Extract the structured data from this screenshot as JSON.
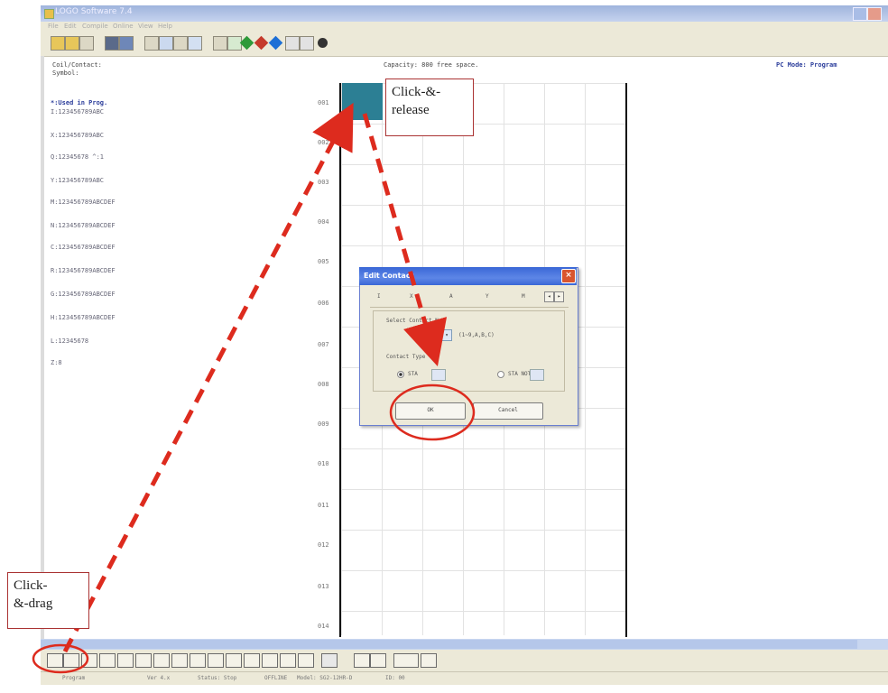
{
  "window": {
    "title": "LOGO Software 7.4",
    "menu": [
      "File",
      "Edit",
      "Compile",
      "Online",
      "View",
      "Help"
    ]
  },
  "info": {
    "coil_contact_label": "Coil/Contact:",
    "symbol_label": "Symbol:",
    "capacity": "Capacity: 800 free space.",
    "mode": "PC Mode: Program",
    "used_header": "*:Used in Prog.",
    "ranges": [
      "I:123456789ABC",
      "X:123456789ABC",
      "Q:12345678 ^:1",
      "Y:123456789ABC",
      "M:123456789ABCDEF",
      "N:123456789ABCDEF",
      "C:123456789ABCDEF",
      "R:123456789ABCDEF",
      "G:123456789ABCDEF",
      "H:123456789ABCDEF",
      "L:12345678",
      "Z:8"
    ]
  },
  "ladder": {
    "rows": [
      "001",
      "002",
      "003",
      "004",
      "005",
      "006",
      "007",
      "008",
      "009",
      "010",
      "011",
      "012",
      "013",
      "014"
    ]
  },
  "dialog": {
    "title": "Edit Contact",
    "tabs": [
      "I",
      "X",
      "A",
      "Y",
      "M"
    ],
    "select_label": "Select Contact No.",
    "contact_prefix": "I",
    "contact_no": "1",
    "contact_range": "(1~9,A,B,C)",
    "type_label": "Contact Type",
    "type_options": [
      "STA",
      "STA NOT"
    ],
    "ok": "OK",
    "cancel": "Cancel"
  },
  "status": {
    "items": [
      "Program",
      "Ver 4.x",
      "Status: Stop",
      "OFFLINE",
      "Model: SG2-12HR-D",
      "ID: 00"
    ]
  },
  "annotations": {
    "click_release": [
      "Click-&-",
      "release"
    ],
    "click_drag": [
      "Click-",
      "&-drag"
    ]
  },
  "colors": {
    "annotation": "#dd2b1e",
    "selected_cell": "#2c7f94",
    "used_text": "#2b3d9b"
  }
}
